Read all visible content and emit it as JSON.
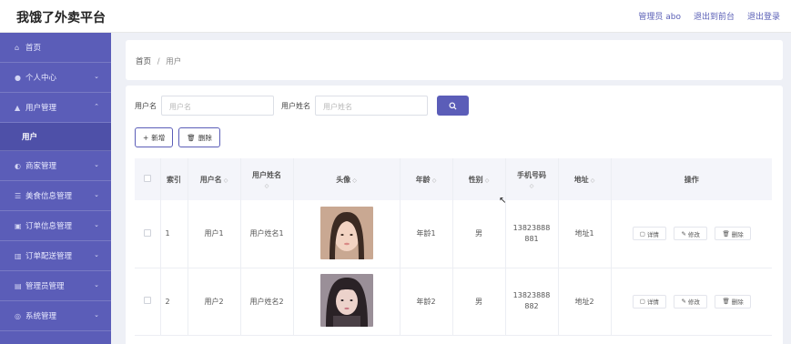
{
  "header": {
    "brand": "我饿了外卖平台",
    "admin_label": "管理员 abo",
    "to_front": "退出到前台",
    "logout": "退出登录"
  },
  "sidebar": {
    "items": [
      {
        "label": "首页",
        "icon": "home-icon",
        "chev": ""
      },
      {
        "label": "个人中心",
        "icon": "person-icon",
        "chev": "⌄"
      },
      {
        "label": "用户管理",
        "icon": "users-icon",
        "chev": "⌃"
      },
      {
        "label": "用户",
        "icon": "",
        "chev": ""
      },
      {
        "label": "商家管理",
        "icon": "shop-icon",
        "chev": "⌄"
      },
      {
        "label": "美食信息管理",
        "icon": "list-icon",
        "chev": "⌄"
      },
      {
        "label": "订单信息管理",
        "icon": "order-icon",
        "chev": "⌄"
      },
      {
        "label": "订单配送管理",
        "icon": "chart-icon",
        "chev": "⌄"
      },
      {
        "label": "管理员管理",
        "icon": "admin-icon",
        "chev": "⌄"
      },
      {
        "label": "系统管理",
        "icon": "settings-icon",
        "chev": "⌄"
      }
    ]
  },
  "breadcrumb": {
    "home": "首页",
    "sep": "/",
    "current": "用户"
  },
  "search": {
    "username_label": "用户名",
    "username_placeholder": "用户名",
    "realname_label": "用户姓名",
    "realname_placeholder": "用户姓名"
  },
  "toolbar": {
    "add_label": "新增",
    "delete_label": "删除"
  },
  "table": {
    "headers": {
      "index": "索引",
      "username": "用户名",
      "realname": "用户姓名",
      "avatar": "头像",
      "age": "年龄",
      "gender": "性别",
      "phone": "手机号码",
      "address": "地址",
      "actions": "操作"
    },
    "actions": {
      "detail": "详情",
      "edit": "修改",
      "delete": "删除"
    },
    "rows": [
      {
        "index": "1",
        "username": "用户1",
        "realname": "用户姓名1",
        "age": "年龄1",
        "gender": "男",
        "phone": "13823888881",
        "address": "地址1"
      },
      {
        "index": "2",
        "username": "用户2",
        "realname": "用户姓名2",
        "age": "年龄2",
        "gender": "男",
        "phone": "13823888882",
        "address": "地址2"
      }
    ]
  }
}
